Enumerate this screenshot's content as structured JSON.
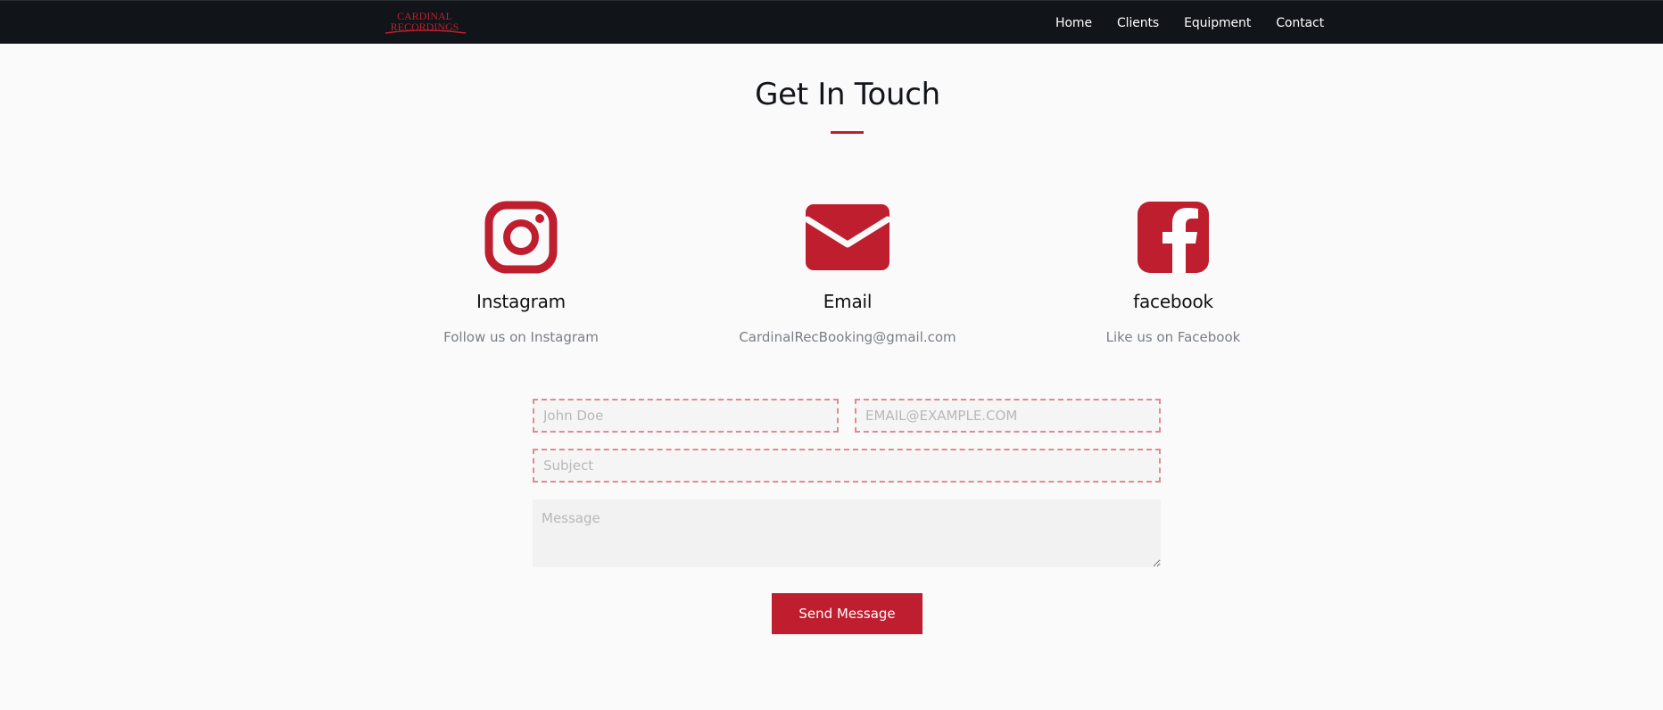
{
  "brand": {
    "logo_line1": "CARDINAL",
    "logo_line2": "RECORDINGS",
    "accent_color": "#be1e2d",
    "nav_bg_color": "#111418"
  },
  "nav": {
    "items": [
      {
        "label": "Home"
      },
      {
        "label": "Clients"
      },
      {
        "label": "Equipment"
      },
      {
        "label": "Contact"
      }
    ]
  },
  "main": {
    "title": "Get In Touch"
  },
  "contacts": [
    {
      "icon": "instagram-icon",
      "title": "Instagram",
      "subtitle": "Follow us on Instagram"
    },
    {
      "icon": "email-icon",
      "title": "Email",
      "subtitle": "CardinalRecBooking@gmail.com"
    },
    {
      "icon": "facebook-icon",
      "title": "facebook",
      "subtitle": "Like us on Facebook"
    }
  ],
  "form": {
    "name_placeholder": "John Doe",
    "email_placeholder": "EMAIL@EXAMPLE.COM",
    "subject_placeholder": "Subject",
    "message_placeholder": "Message",
    "submit_label": "Send Message"
  }
}
